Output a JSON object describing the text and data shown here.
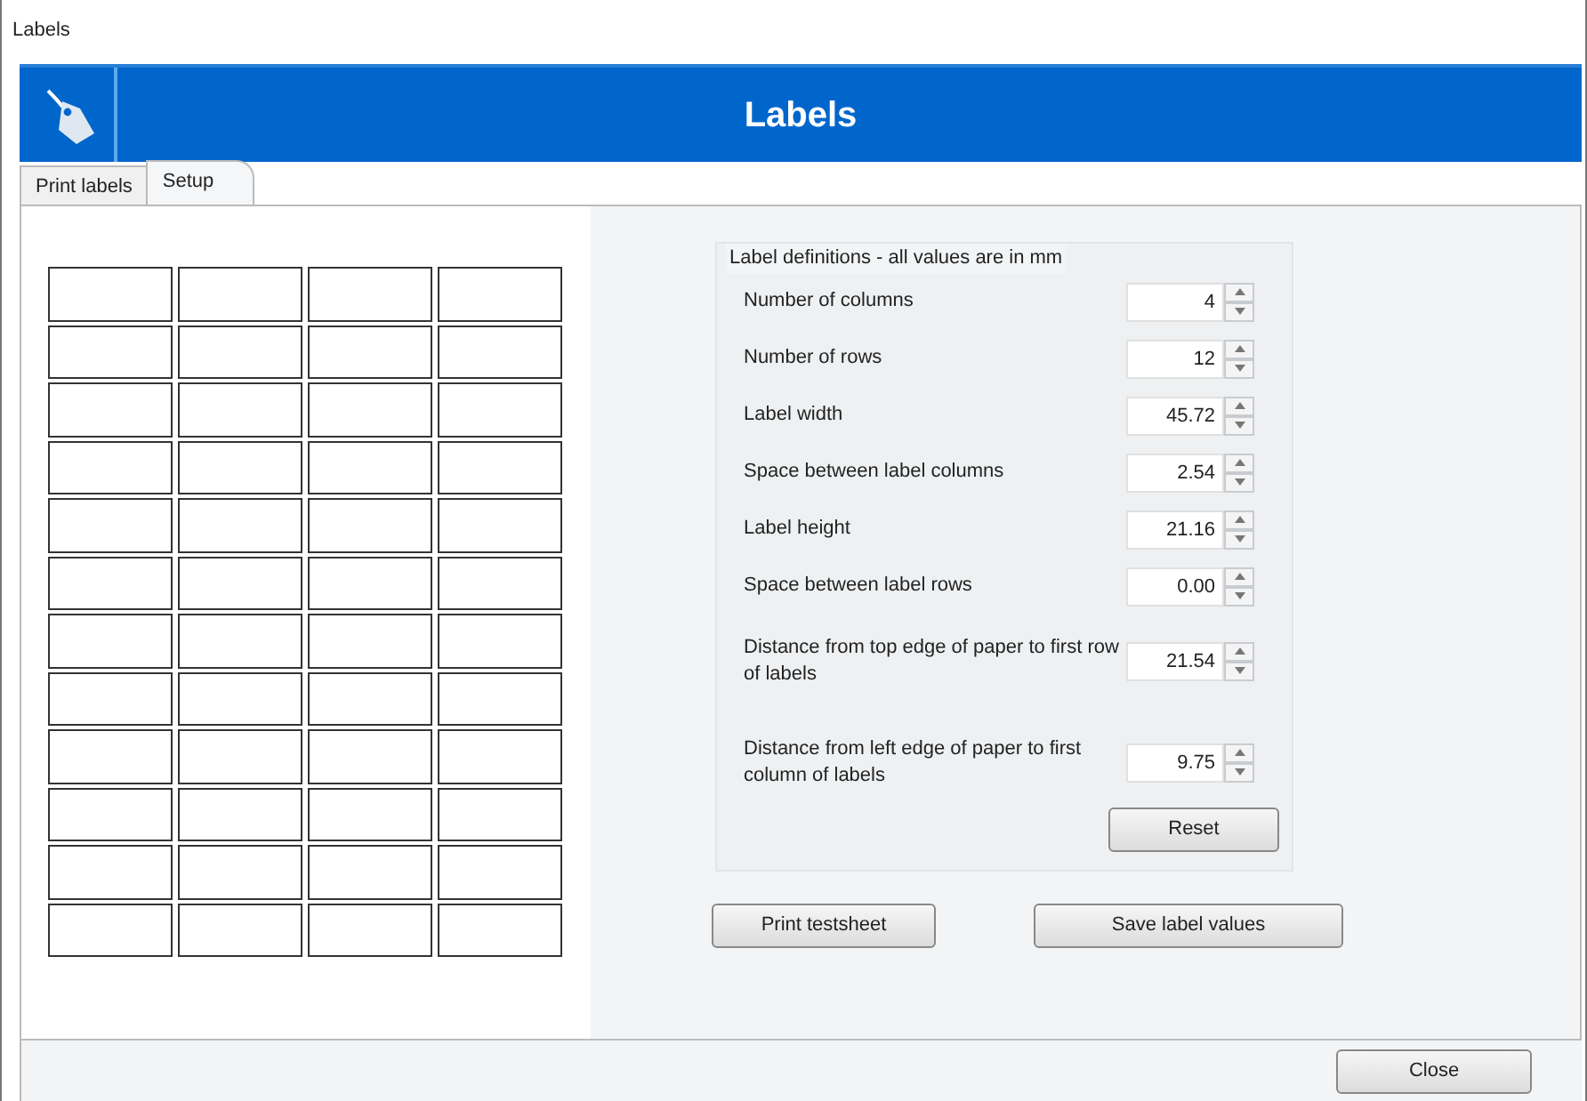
{
  "window": {
    "title": "Labels"
  },
  "header": {
    "title": "Labels"
  },
  "tabs": [
    {
      "label": "Print labels",
      "selected": false
    },
    {
      "label": "Setup",
      "selected": true
    }
  ],
  "definitions": {
    "legend": "Label definitions - all values are in mm",
    "fields": [
      {
        "label": "Number of columns",
        "value": "4"
      },
      {
        "label": "Number of rows",
        "value": "12"
      },
      {
        "label": "Label width",
        "value": "45.72"
      },
      {
        "label": "Space between label columns",
        "value": "2.54"
      },
      {
        "label": "Label height",
        "value": "21.16"
      },
      {
        "label": "Space between label rows",
        "value": "0.00"
      },
      {
        "label": "Distance from top edge of paper to first row of labels",
        "value": "21.54"
      },
      {
        "label": "Distance from left edge of paper to first column of labels",
        "value": "9.75"
      }
    ],
    "reset_button": "Reset"
  },
  "buttons": [
    "Print testsheet",
    "Save label values"
  ],
  "footer": {
    "close_button": "Close"
  }
}
